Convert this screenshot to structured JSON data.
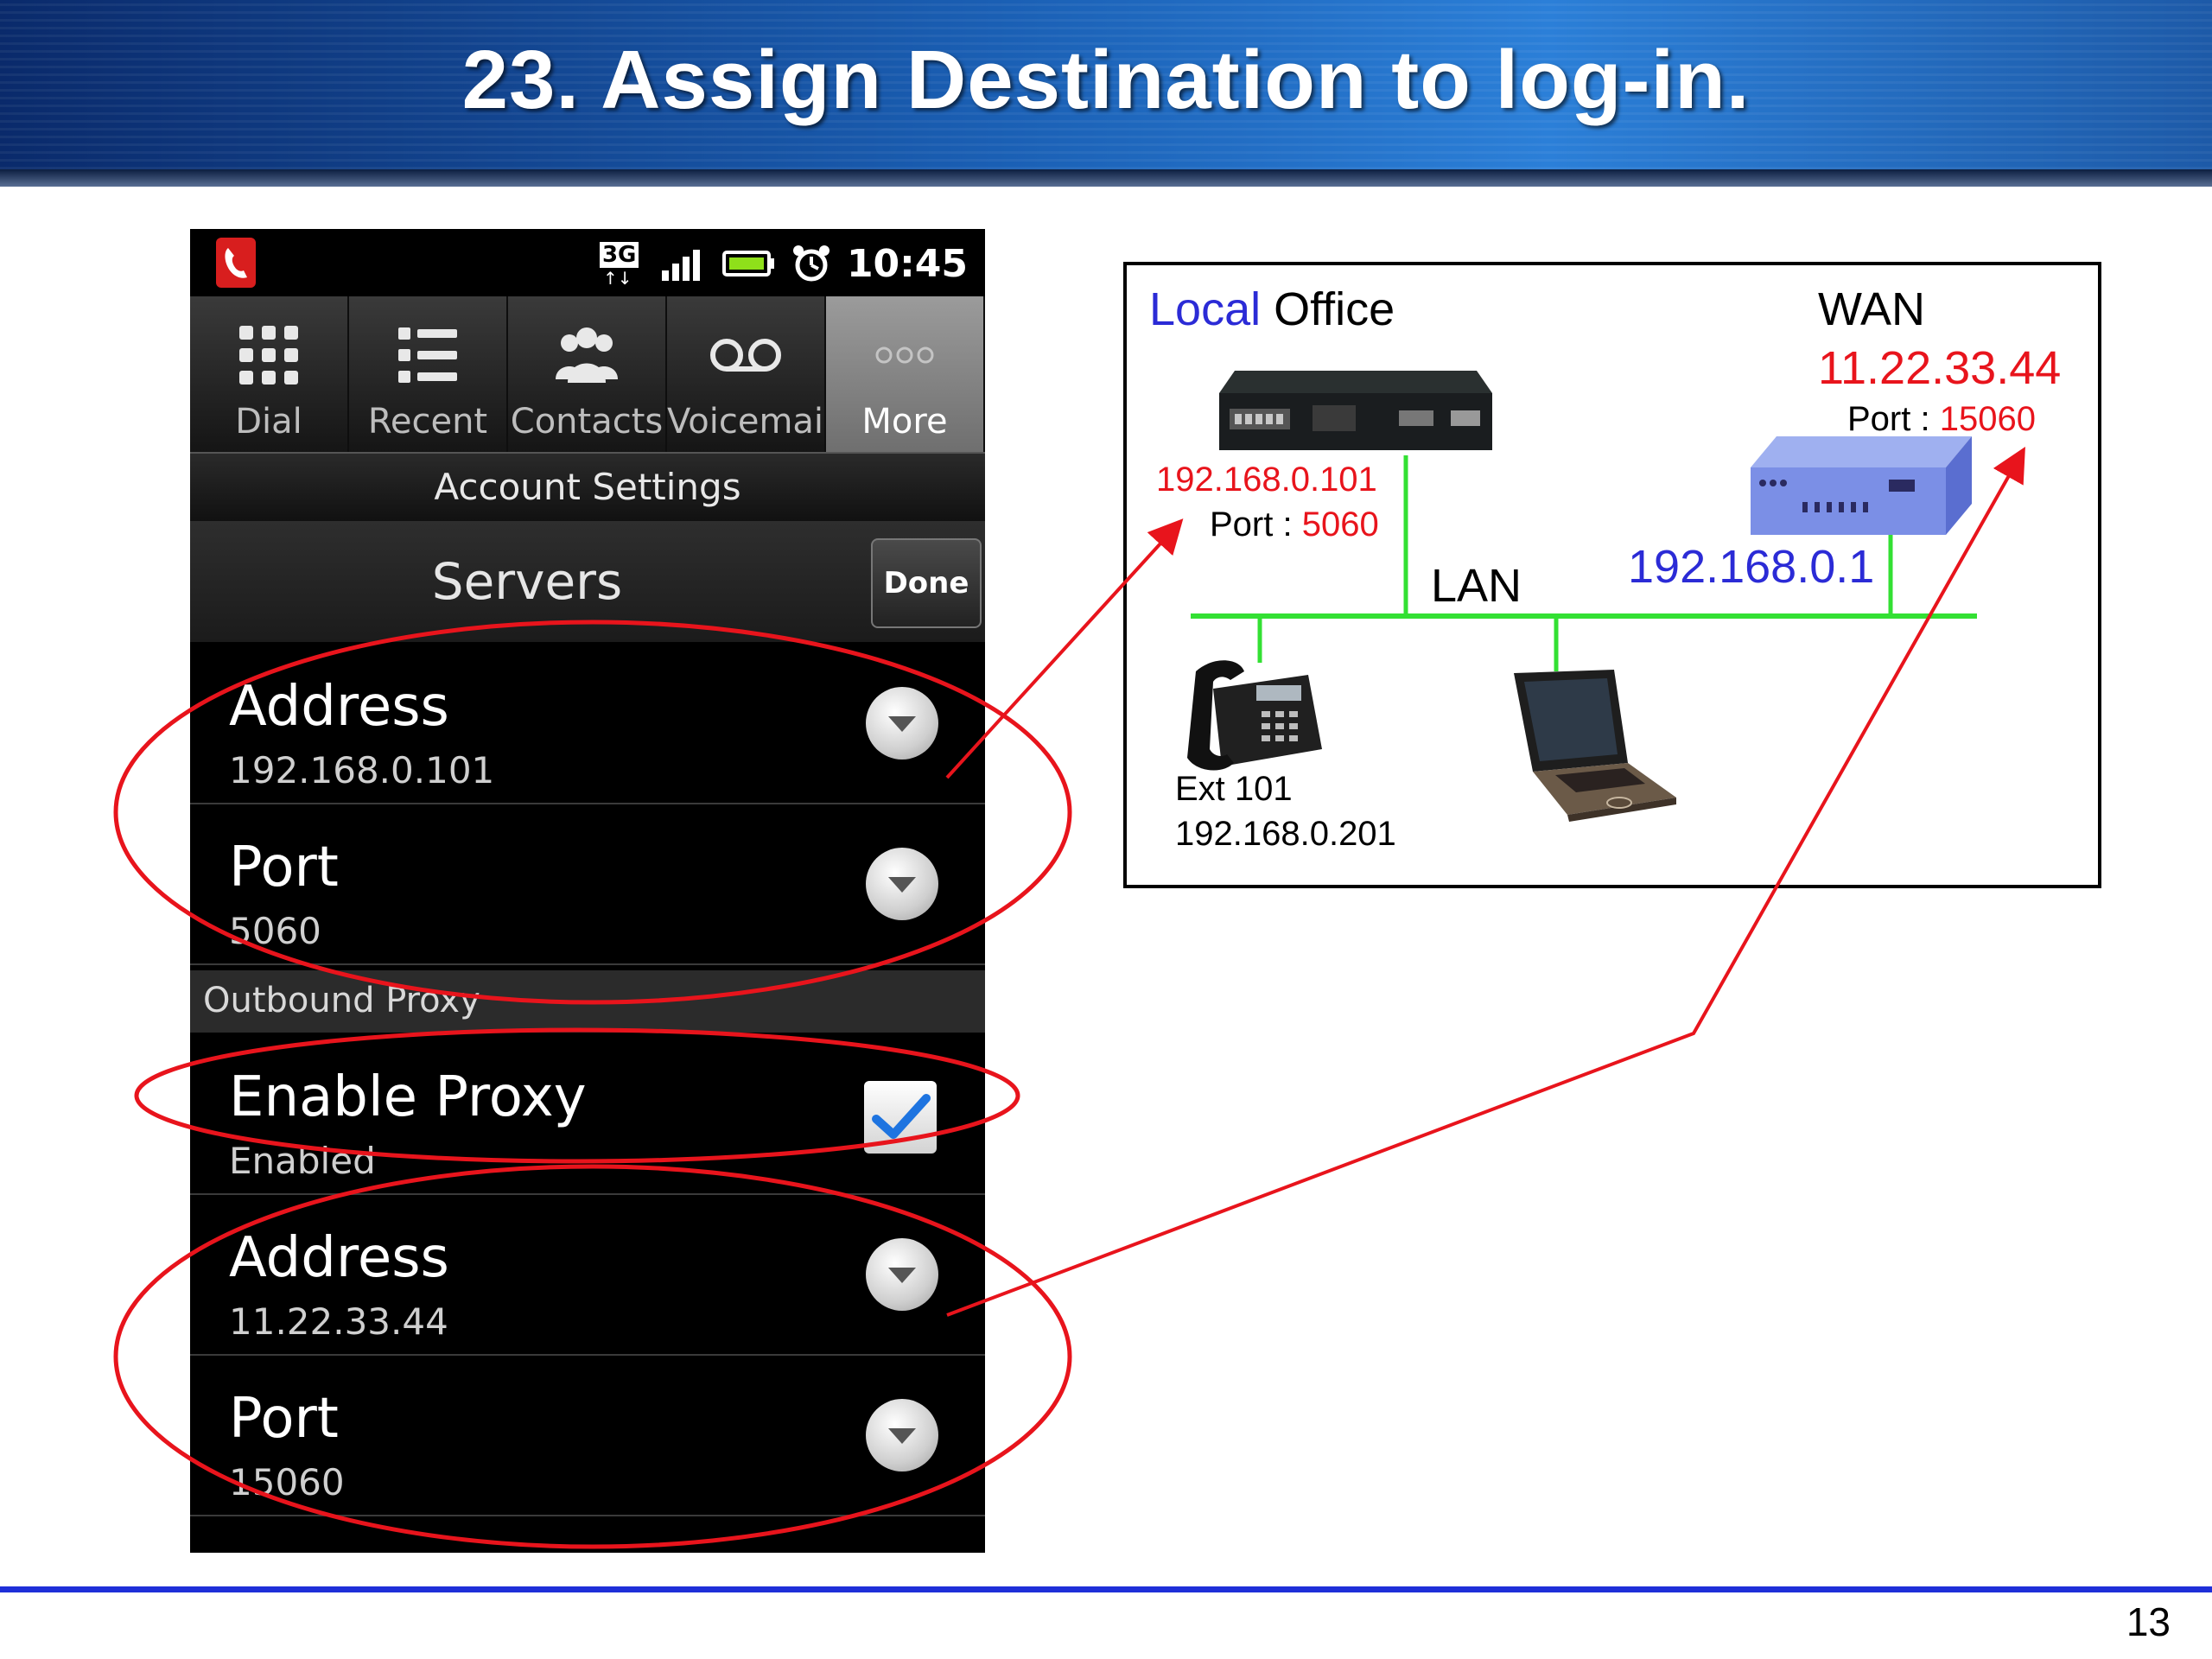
{
  "slide": {
    "title": "23. Assign Destination to log-in.",
    "page_number": "13"
  },
  "phone": {
    "status": {
      "network": "3G",
      "time": "10:45"
    },
    "tabs": [
      {
        "label": "Dial",
        "icon": "dial-grid-icon"
      },
      {
        "label": "Recent",
        "icon": "list-icon"
      },
      {
        "label": "Contacts",
        "icon": "contacts-icon"
      },
      {
        "label": "Voicemail",
        "icon": "voicemail-icon"
      },
      {
        "label": "More",
        "icon": "more-icon",
        "active": true
      }
    ],
    "account_settings": "Account Settings",
    "servers": {
      "title": "Servers",
      "done": "Done"
    },
    "server_address": {
      "label": "Address",
      "value": "192.168.0.101"
    },
    "server_port": {
      "label": "Port",
      "value": "5060"
    },
    "outbound_proxy_header": "Outbound Proxy",
    "enable_proxy": {
      "label": "Enable Proxy",
      "value": "Enabled",
      "checked": true
    },
    "proxy_address": {
      "label": "Address",
      "value": "11.22.33.44"
    },
    "proxy_port": {
      "label": "Port",
      "value": "15060"
    }
  },
  "diagram": {
    "local": "Local",
    "office": "Office",
    "wan": "WAN",
    "wan_ip": "11.22.33.44",
    "wan_port_label": "Port : ",
    "wan_port": "15060",
    "pbx_ip": "192.168.0.101",
    "pbx_port_label": "Port : ",
    "pbx_port": "5060",
    "lan": "LAN",
    "router_ip": "192.168.0.1",
    "ext": "Ext 101",
    "ext_ip": "192.168.0.201"
  },
  "colors": {
    "highlight_red": "#e8141c",
    "lan_green": "#33e033",
    "lan_blue": "#2b2bd6",
    "footer_blue": "#1e2fd8"
  }
}
